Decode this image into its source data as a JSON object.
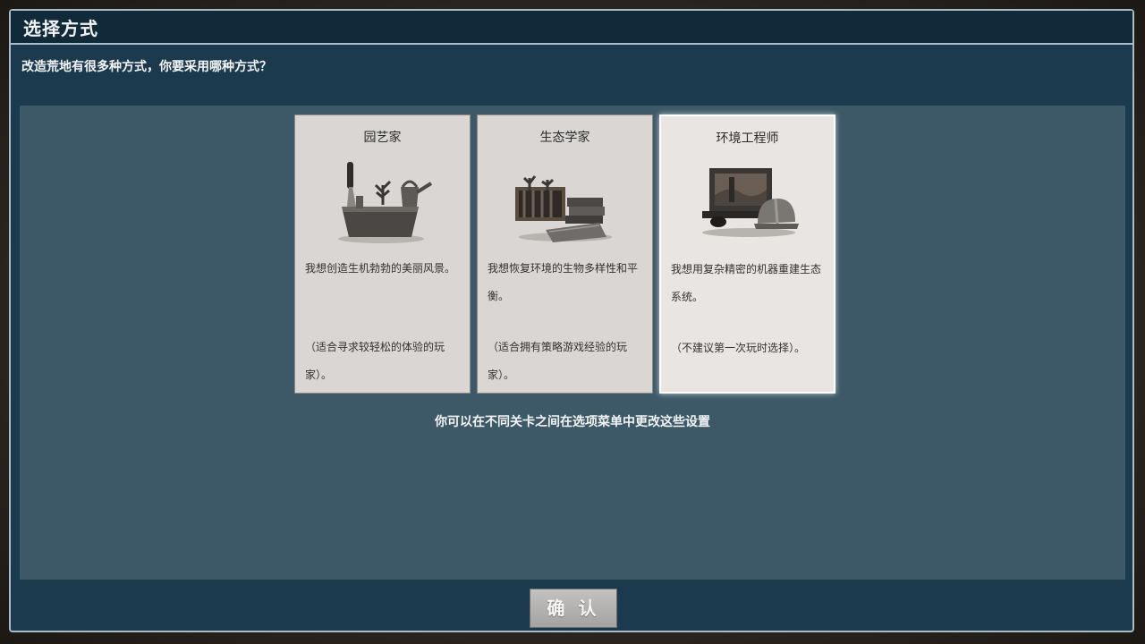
{
  "dialog": {
    "title": "选择方式",
    "question": "改造荒地有很多种方式，你要采用哪种方式？",
    "hint": "你可以在不同关卡之间在选项菜单中更改这些设置",
    "confirm_label": "确 认"
  },
  "cards": [
    {
      "title": "园艺家",
      "icon": "gardening-tools-icon",
      "description": "我想创造生机勃勃的美丽风景。",
      "note": "（适合寻求较轻松的体验的玩家）。",
      "selected": false
    },
    {
      "title": "生态学家",
      "icon": "ecology-books-icon",
      "description": "我想恢复环境的生物多样性和平衡。",
      "note": "（适合拥有策略游戏经验的玩家）。",
      "selected": false
    },
    {
      "title": "环境工程师",
      "icon": "engineering-gear-icon",
      "description": "我想用复杂精密的机器重建生态系统。",
      "note": "（不建议第一次玩时选择）。",
      "selected": true
    }
  ],
  "colors": {
    "dialog_bg": "#1c3a4d",
    "panel_bg": "#3d5967",
    "card_bg": "#d9d6d3",
    "text_light": "#f2f4f5"
  }
}
